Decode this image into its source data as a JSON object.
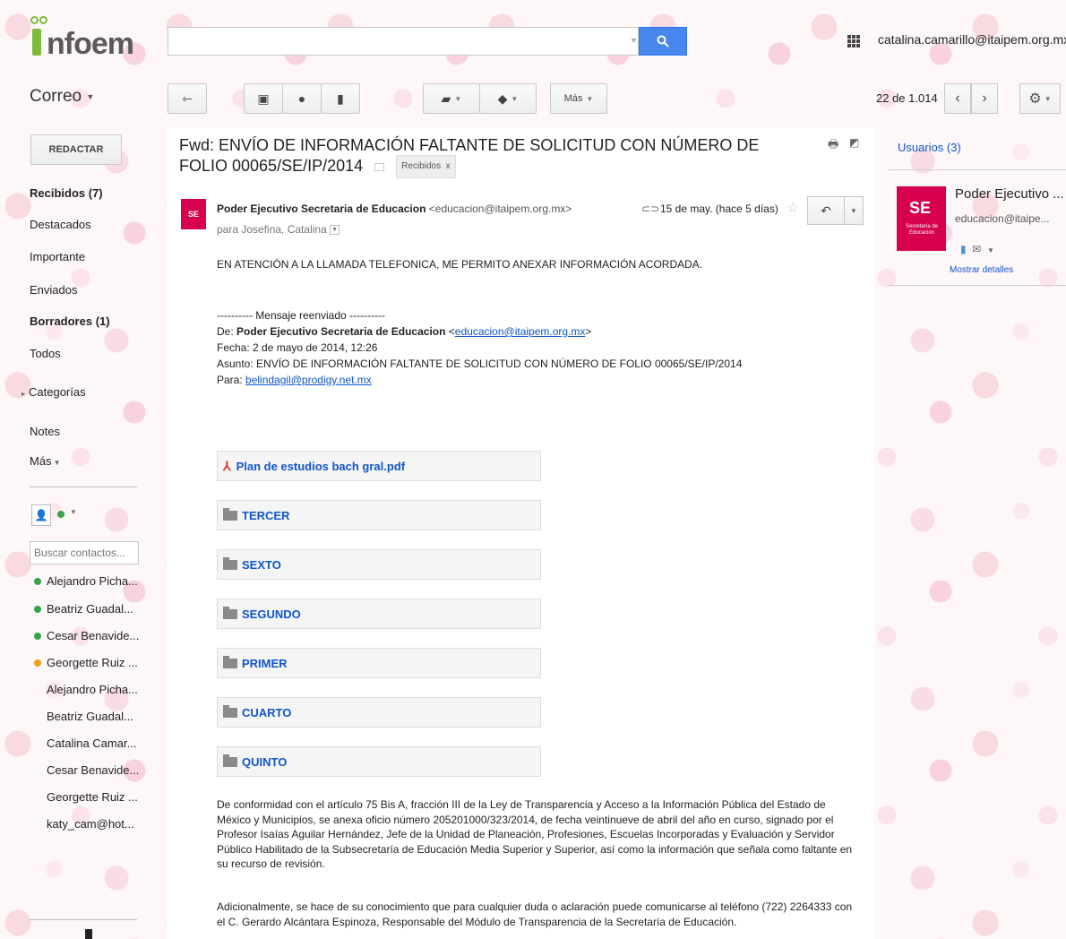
{
  "brand": {
    "logo_text": "nfoem"
  },
  "search": {
    "value": "",
    "placeholder": ""
  },
  "header": {
    "user_email": "catalina.camarillo@itaipem.org.mx"
  },
  "app_menu": {
    "label": "Correo"
  },
  "toolbar": {
    "more_label": "Más"
  },
  "pager": {
    "text": "22 de 1.014"
  },
  "sidebar": {
    "compose_label": "REDACTAR",
    "items": [
      {
        "label": "Recibidos (7)",
        "bold": true
      },
      {
        "label": "Destacados"
      },
      {
        "label": "Importante"
      },
      {
        "label": "Enviados"
      },
      {
        "label": "Borradores (1)",
        "bold": true
      },
      {
        "label": "Todos"
      },
      {
        "label": "Categorías"
      },
      {
        "label": "Notes"
      },
      {
        "label": "Más"
      }
    ]
  },
  "contacts": {
    "search_placeholder": "Buscar contactos...",
    "list": [
      {
        "name": "Alejandro Picha...",
        "status": "online"
      },
      {
        "name": "Beatriz Guadal...",
        "status": "online"
      },
      {
        "name": "Cesar Benavide...",
        "status": "online"
      },
      {
        "name": "Georgette Ruiz ...",
        "status": "away"
      },
      {
        "name": "Alejandro Picha...",
        "status": "none"
      },
      {
        "name": "Beatriz Guadal...",
        "status": "none"
      },
      {
        "name": "Catalina Camar...",
        "status": "none"
      },
      {
        "name": "Cesar Benavide...",
        "status": "none"
      },
      {
        "name": "Georgette Ruiz ...",
        "status": "none"
      },
      {
        "name": "katy_cam@hot...",
        "status": "none"
      }
    ]
  },
  "message": {
    "subject": "Fwd: ENVÍO DE INFORMACIÓN FALTANTE DE SOLICITUD CON NÚMERO DE FOLIO 00065/SE/IP/2014",
    "label": "Recibidos",
    "label_close": "x",
    "sender_name": "Poder Ejecutivo Secretaria de Educacion",
    "sender_email": "<educacion@itaipem.org.mx>",
    "recipients": "para Josefina, Catalina",
    "date": "15 de may. (hace 5 días)",
    "body_first": "EN ATENCIÓN A LA LLAMADA TELEFONICA, ME PERMITO ANEXAR INFORMACIÓN ACORDADA.",
    "forwarded": {
      "header": "---------- Mensaje reenviado ----------",
      "from_label": "De:",
      "from_name": "Poder Ejecutivo Secretaria de Educacion",
      "from_email": "educacion@itaipem.org.mx",
      "date_line": "Fecha: 2 de mayo de 2014, 12:26",
      "subject_line": "Asunto: ENVÍO DE INFORMACIÓN FALTANTE DE SOLICITUD CON NÚMERO DE FOLIO 00065/SE/IP/2014",
      "to_label": "Para:",
      "to_email": "belindagil@prodigy.net.mx"
    },
    "attachments": [
      {
        "name": "Plan de estudios bach gral.pdf",
        "type": "pdf"
      },
      {
        "name": "TERCER",
        "type": "folder"
      },
      {
        "name": "SEXTO",
        "type": "folder"
      },
      {
        "name": "SEGUNDO",
        "type": "folder"
      },
      {
        "name": "PRIMER",
        "type": "folder"
      },
      {
        "name": "CUARTO",
        "type": "folder"
      },
      {
        "name": "QUINTO",
        "type": "folder"
      }
    ],
    "paragraph1": "De conformidad con el artículo 75 Bis A, fracción III de la Ley de Transparencia y Acceso a la Información Pública del Estado de México y Municipios, se anexa oficio número 205201000/323/2014, de fecha veintinueve de abril del año en curso, signado por el Profesor Isaías Aguilar Hernández, Jefe de la Unidad de Planeación, Profesiones, Escuelas Incorporadas y Evaluación y Servidor Público Habilitado de la Subsecretaría de Educación Media Superior y Superior, así como la información que señala como faltante en su recurso de revisión.",
    "paragraph2": "Adicionalmente, se hace de su conocimiento que para cualquier duda o aclaración puede comunicarse al teléfono (722) 2264333  con el C. Gerardo Alcántara Espinoza, Responsable del Módulo de Transparencia de la Secretaría de Educación."
  },
  "people": {
    "title": "Usuarios (3)",
    "card_name": "Poder Ejecutivo ...",
    "card_email": "educacion@itaipe...",
    "details_link": "Mostrar detalles",
    "logo_text": "SE",
    "logo_sub": "Secretaría de Educación"
  },
  "colors": {
    "accent_blue": "#4787ed",
    "link": "#1155cc",
    "brand_pink": "#d6004f",
    "online": "#36a34a",
    "away": "#f0a020"
  }
}
